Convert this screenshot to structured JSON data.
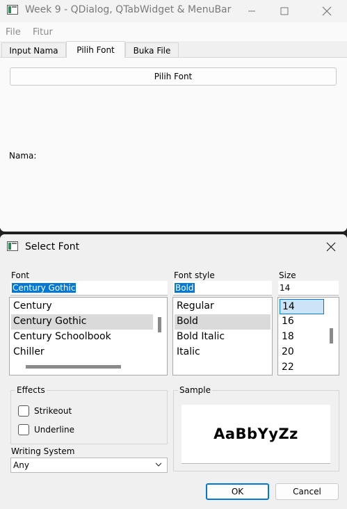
{
  "main_window": {
    "title": "Week 9 - QDialog, QTabWidget & MenuBar",
    "menu": [
      "File",
      "Fitur"
    ],
    "tabs": [
      {
        "label": "Input Nama",
        "active": false
      },
      {
        "label": "Pilih Font",
        "active": true
      },
      {
        "label": "Buka File",
        "active": false
      }
    ],
    "pilih_font_button": "Pilih Font",
    "nama_label": "Nama:"
  },
  "dialog": {
    "title": "Select Font",
    "font": {
      "label": "Font",
      "value": "Century Gothic",
      "items": [
        "Century",
        "Century Gothic",
        "Century Schoolbook",
        "Chiller"
      ],
      "selected": "Century Gothic"
    },
    "style": {
      "label": "Font style",
      "value": "Bold",
      "items": [
        "Regular",
        "Bold",
        "Bold Italic",
        "Italic"
      ],
      "selected": "Bold"
    },
    "size": {
      "label": "Size",
      "value": "14",
      "items": [
        "14",
        "16",
        "18",
        "20",
        "22"
      ],
      "selected": "14"
    },
    "effects": {
      "label": "Effects",
      "strikeout_label": "Strikeout",
      "strikeout_checked": false,
      "underline_label": "Underline",
      "underline_checked": false
    },
    "sample": {
      "label": "Sample",
      "text": "AaBbYyZz"
    },
    "writing_system": {
      "label": "Writing System",
      "value": "Any"
    },
    "ok_label": "OK",
    "cancel_label": "Cancel"
  },
  "colors": {
    "accent": "#0078d7",
    "selection_bg": "#dadada"
  },
  "icons": {
    "app": "window-app-icon",
    "minimize": "minimize-icon",
    "maximize": "maximize-icon",
    "close": "close-icon",
    "chevron": "chevron-down-icon"
  }
}
